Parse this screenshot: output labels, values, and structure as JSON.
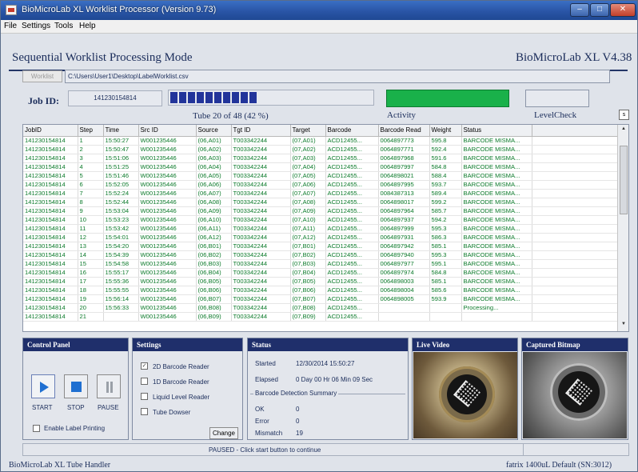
{
  "window": {
    "title": "BioMicroLab XL Worklist Processor  (Version 9.73)"
  },
  "menu": [
    "File",
    "Settings",
    "Tools",
    "Help"
  ],
  "header": {
    "mode_title": "Sequential Worklist Processing Mode",
    "version": "BioMicroLab XL V4.38",
    "worklist_button": "Worklist",
    "worklist_path": "C:\\Users\\User1\\Desktop\\LabelWorklist.csv",
    "job_id_label": "Job ID:",
    "job_id_value": "141230154814",
    "tube_progress_text": "Tube 20 of 48  (42 %)",
    "progress_fraction": 0.42,
    "activity_label": "Activity",
    "level_check_label": "LevelCheck",
    "small_box": "s"
  },
  "colors": {
    "activity": "#19b14a",
    "panel_title": "#1f2f6b",
    "grid_text": "#0b7a2a",
    "progress": "#22349a"
  },
  "table": {
    "columns": [
      "JobID",
      "Step",
      "Time",
      "Src ID",
      "Source",
      "Tgt ID",
      "Target",
      "Barcode",
      "Barcode Read",
      "Weight",
      "Status"
    ],
    "rows": [
      [
        "141230154814",
        "1",
        "15:50:27",
        "W001235446",
        "(06,A01)",
        "T003342244",
        "(07,A01)",
        "ACD12455...",
        "0064897773",
        "595.8",
        "BARCODE MISMA..."
      ],
      [
        "141230154814",
        "2",
        "15:50:47",
        "W001235446",
        "(06,A02)",
        "T003342244",
        "(07,A02)",
        "ACD12455...",
        "0064897771",
        "592.4",
        "BARCODE MISMA..."
      ],
      [
        "141230154814",
        "3",
        "15:51:06",
        "W001235446",
        "(06,A03)",
        "T003342244",
        "(07,A03)",
        "ACD12455...",
        "0064897968",
        "591.6",
        "BARCODE MISMA..."
      ],
      [
        "141230154814",
        "4",
        "15:51:25",
        "W001235446",
        "(06,A04)",
        "T003342244",
        "(07,A04)",
        "ACD12455...",
        "0064897997",
        "584.8",
        "BARCODE MISMA..."
      ],
      [
        "141230154814",
        "5",
        "15:51:46",
        "W001235446",
        "(06,A05)",
        "T003342244",
        "(07,A05)",
        "ACD12455...",
        "0064898021",
        "588.4",
        "BARCODE MISMA..."
      ],
      [
        "141230154814",
        "6",
        "15:52:05",
        "W001235446",
        "(06,A06)",
        "T003342244",
        "(07,A06)",
        "ACD12455...",
        "0064897995",
        "593.7",
        "BARCODE MISMA..."
      ],
      [
        "141230154814",
        "7",
        "15:52:24",
        "W001235446",
        "(06,A07)",
        "T003342244",
        "(07,A07)",
        "ACD12455...",
        "0084387313",
        "589.4",
        "BARCODE MISMA..."
      ],
      [
        "141230154814",
        "8",
        "15:52:44",
        "W001235446",
        "(06,A08)",
        "T003342244",
        "(07,A08)",
        "ACD12455...",
        "0064898017",
        "599.2",
        "BARCODE MISMA..."
      ],
      [
        "141230154814",
        "9",
        "15:53:04",
        "W001235446",
        "(06,A09)",
        "T003342244",
        "(07,A09)",
        "ACD12455...",
        "0064897964",
        "585.7",
        "BARCODE MISMA..."
      ],
      [
        "141230154814",
        "10",
        "15:53:23",
        "W001235446",
        "(06,A10)",
        "T003342244",
        "(07,A10)",
        "ACD12455...",
        "0064897937",
        "594.2",
        "BARCODE MISMA..."
      ],
      [
        "141230154814",
        "11",
        "15:53:42",
        "W001235446",
        "(06,A11)",
        "T003342244",
        "(07,A11)",
        "ACD12455...",
        "0064897999",
        "595.3",
        "BARCODE MISMA..."
      ],
      [
        "141230154814",
        "12",
        "15:54:01",
        "W001235446",
        "(06,A12)",
        "T003342244",
        "(07,A12)",
        "ACD12455...",
        "0064897931",
        "586.3",
        "BARCODE MISMA..."
      ],
      [
        "141230154814",
        "13",
        "15:54:20",
        "W001235446",
        "(06,B01)",
        "T003342244",
        "(07,B01)",
        "ACD12455...",
        "0064897942",
        "585.1",
        "BARCODE MISMA..."
      ],
      [
        "141230154814",
        "14",
        "15:54:39",
        "W001235446",
        "(06,B02)",
        "T003342244",
        "(07,B02)",
        "ACD12455...",
        "0064897940",
        "595.3",
        "BARCODE MISMA..."
      ],
      [
        "141230154814",
        "15",
        "15:54:58",
        "W001235446",
        "(06,B03)",
        "T003342244",
        "(07,B03)",
        "ACD12455...",
        "0064897977",
        "595.1",
        "BARCODE MISMA..."
      ],
      [
        "141230154814",
        "16",
        "15:55:17",
        "W001235446",
        "(06,B04)",
        "T003342244",
        "(07,B04)",
        "ACD12455...",
        "0064897974",
        "584.8",
        "BARCODE MISMA..."
      ],
      [
        "141230154814",
        "17",
        "15:55:36",
        "W001235446",
        "(06,B05)",
        "T003342244",
        "(07,B05)",
        "ACD12455...",
        "0064898003",
        "585.1",
        "BARCODE MISMA..."
      ],
      [
        "141230154814",
        "18",
        "15:55:55",
        "W001235446",
        "(06,B06)",
        "T003342244",
        "(07,B06)",
        "ACD12455...",
        "0064898004",
        "585.6",
        "BARCODE MISMA..."
      ],
      [
        "141230154814",
        "19",
        "15:56:14",
        "W001235446",
        "(06,B07)",
        "T003342244",
        "(07,B07)",
        "ACD12455...",
        "0064898005",
        "593.9",
        "BARCODE MISMA..."
      ],
      [
        "141230154814",
        "20",
        "15:56:33",
        "W001235446",
        "(06,B08)",
        "T003342244",
        "(07,B08)",
        "ACD12455...",
        "",
        "",
        "Processing..."
      ],
      [
        "141230154814",
        "21",
        "",
        "W001235446",
        "(06,B09)",
        "T003342244",
        "(07,B09)",
        "ACD12455...",
        "",
        "",
        ""
      ]
    ]
  },
  "control_panel": {
    "title": "Control Panel",
    "start": "START",
    "stop": "STOP",
    "pause": "PAUSE",
    "enable_label_printing": "Enable Label Printing"
  },
  "settings": {
    "title": "Settings",
    "options": [
      {
        "label": "2D Barcode Reader",
        "checked": true
      },
      {
        "label": "1D Barcode Reader",
        "checked": false
      },
      {
        "label": "Liquid Level Reader",
        "checked": false
      },
      {
        "label": "Tube Dowser",
        "checked": false
      }
    ],
    "change_button": "Change"
  },
  "status": {
    "title": "Status",
    "started_label": "Started",
    "started_value": "12/30/2014    15:50:27",
    "elapsed_label": "Elapsed",
    "elapsed_value": "0 Day 00 Hr 06 Min 09 Sec",
    "summary_title": "Barcode Detection Summary",
    "ok_label": "OK",
    "ok_value": "0",
    "error_label": "Error",
    "error_value": "0",
    "mismatch_label": "Mismatch",
    "mismatch_value": "19"
  },
  "live_video": {
    "title": "Live Video"
  },
  "captured_bitmap": {
    "title": "Captured Bitmap"
  },
  "statusbar": {
    "message": "PAUSED - Click start button to continue"
  },
  "footer": {
    "left": "BioMicroLab XL Tube Handler",
    "right": "fatrix 1400uL Default    (SN:3012)"
  }
}
